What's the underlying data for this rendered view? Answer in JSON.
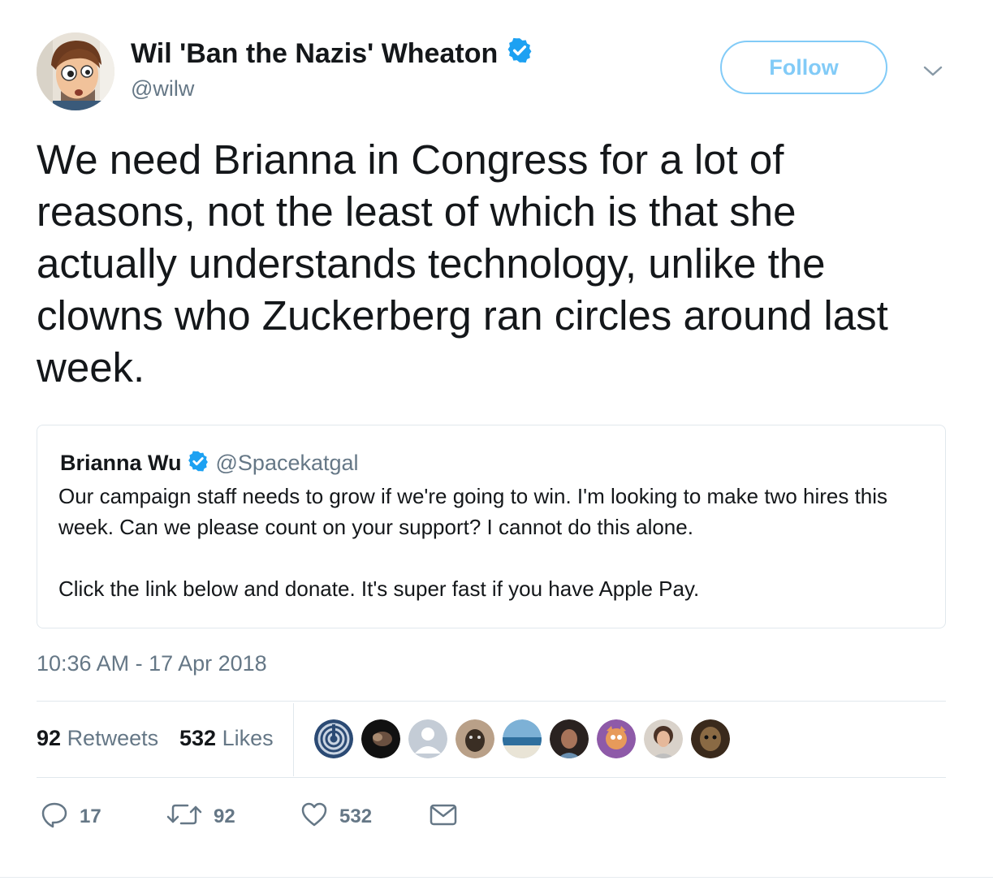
{
  "tweet": {
    "author_name": "Wil 'Ban the Nazis' Wheaton",
    "author_handle": "@wilw",
    "follow_label": "Follow",
    "text": "We need Brianna in Congress for a lot of reasons, not the least of which is that she actually understands technology, unlike the clowns who Zuckerberg ran circles around last week.",
    "timestamp": "10:36 AM - 17 Apr 2018"
  },
  "quoted": {
    "name": "Brianna Wu",
    "handle": "@Spacekatgal",
    "paragraph1": "Our campaign staff needs to grow if we're going to win. I'm looking to make two hires this week. Can we please count on your support? I cannot do this alone.",
    "paragraph2": "Click the link below and donate. It's super fast if you have Apple Pay."
  },
  "stats": {
    "retweets_count": "92",
    "retweets_label": "Retweets",
    "likes_count": "532",
    "likes_label": "Likes",
    "likers_count_shown": 9
  },
  "actions": {
    "reply_count": "17",
    "retweet_count": "92",
    "like_count": "532"
  },
  "icons": {
    "verified": "verified-badge-icon",
    "caret": "chevron-down-icon",
    "reply": "reply-icon",
    "retweet": "retweet-icon",
    "like": "heart-icon",
    "dm": "envelope-icon"
  },
  "colors": {
    "accent": "#1da1f2",
    "text": "#14171a",
    "muted": "#657786",
    "border": "#e1e8ed"
  }
}
